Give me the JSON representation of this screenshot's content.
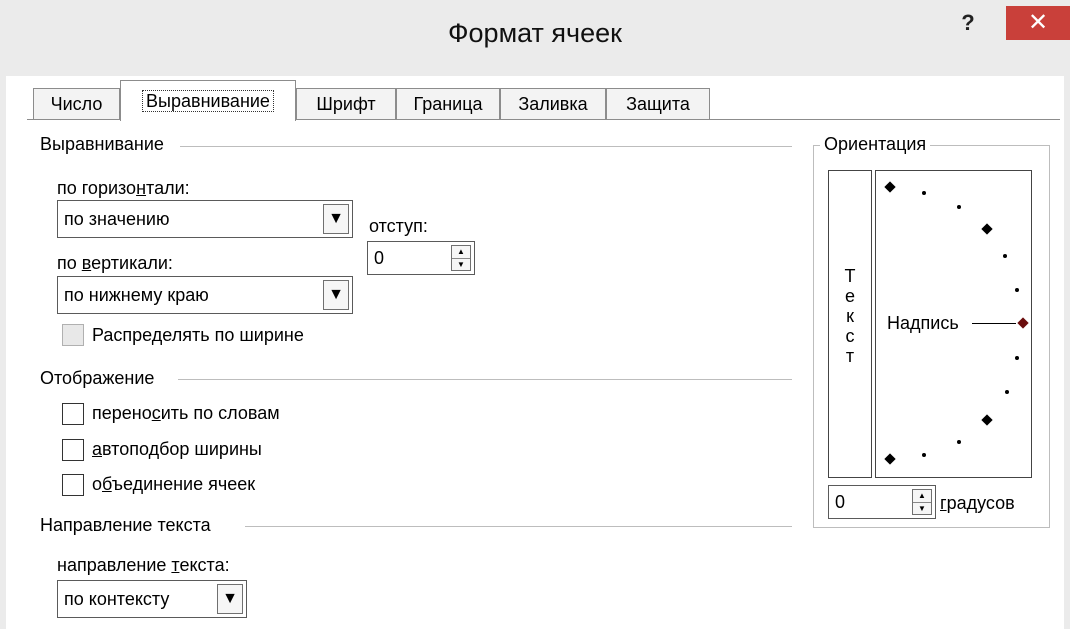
{
  "window": {
    "title": "Формат ячеек",
    "help": "?",
    "close": "✕"
  },
  "tabs": [
    {
      "label": "Число"
    },
    {
      "label": "Выравнивание",
      "active": true
    },
    {
      "label": "Шрифт"
    },
    {
      "label": "Граница"
    },
    {
      "label": "Заливка"
    },
    {
      "label": "Защита"
    }
  ],
  "alignment": {
    "group": "Выравнивание",
    "horizontal_label_a": "по горизо",
    "horizontal_label_u": "н",
    "horizontal_label_b": "тали:",
    "horizontal_value": "по значению",
    "indent_label": "отступ:",
    "indent_value": "0",
    "vertical_label_a": "по ",
    "vertical_label_u": "в",
    "vertical_label_b": "ертикали:",
    "vertical_value": "по нижнему краю",
    "distribute_label": "Распределять по ширине"
  },
  "display": {
    "group": "Отображение",
    "wrap_a": "перено",
    "wrap_u": "с",
    "wrap_b": "ить по словам",
    "shrink_u": "а",
    "shrink_b": "втоподбор ширины",
    "merge_a": "о",
    "merge_u": "б",
    "merge_b": "ъединение ячеек"
  },
  "direction": {
    "group": "Направление текста",
    "label_a": "направление ",
    "label_u": "т",
    "label_b": "екста:",
    "value": "по контексту"
  },
  "orientation": {
    "group": "Ориентация",
    "vertical_text": "Т\nе\nк\nс\nт",
    "dial_label": "Надпись",
    "degrees_value": "0",
    "degrees_u": "г",
    "degrees_b": "радусов"
  },
  "colors": {
    "close_button": "#c9403a",
    "titlebar": "#ebebeb"
  }
}
